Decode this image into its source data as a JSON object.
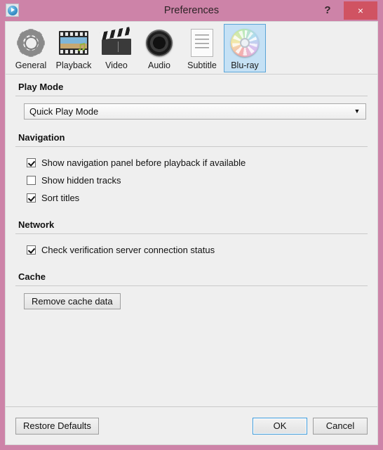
{
  "window": {
    "title": "Preferences",
    "app_icon": "media-player-icon",
    "help_label": "?",
    "close_label": "×",
    "frame_color": "#cd83a8",
    "close_color": "#d05362",
    "accent_color": "#3c9bdc"
  },
  "toolbar": {
    "tabs": [
      {
        "label": "General",
        "icon": "gear-icon",
        "selected": false
      },
      {
        "label": "Playback",
        "icon": "film-icon",
        "selected": false
      },
      {
        "label": "Video",
        "icon": "clapper-icon",
        "selected": false
      },
      {
        "label": "Audio",
        "icon": "speaker-icon",
        "selected": false
      },
      {
        "label": "Subtitle",
        "icon": "document-icon",
        "selected": false
      },
      {
        "label": "Blu-ray",
        "icon": "disc-icon",
        "selected": true
      }
    ]
  },
  "sections": {
    "play_mode": {
      "title": "Play Mode",
      "dropdown": {
        "value": "Quick Play Mode",
        "arrow": "▼"
      }
    },
    "navigation": {
      "title": "Navigation",
      "checkboxes": [
        {
          "label": "Show navigation panel before playback if available",
          "checked": true
        },
        {
          "label": "Show hidden tracks",
          "checked": false
        },
        {
          "label": "Sort titles",
          "checked": true
        }
      ]
    },
    "network": {
      "title": "Network",
      "checkboxes": [
        {
          "label": "Check verification server connection status",
          "checked": true
        }
      ]
    },
    "cache": {
      "title": "Cache",
      "button_label": "Remove cache data"
    }
  },
  "footer": {
    "restore_label": "Restore Defaults",
    "ok_label": "OK",
    "cancel_label": "Cancel"
  }
}
